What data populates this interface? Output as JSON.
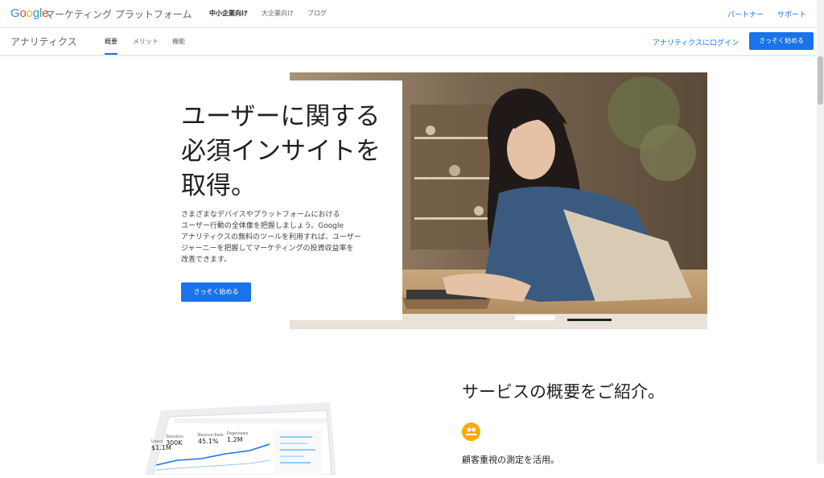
{
  "header": {
    "logo_parts": [
      "G",
      "o",
      "o",
      "g",
      "l",
      "e"
    ],
    "logo_colors": [
      "#4285f4",
      "#ea4335",
      "#fbbc05",
      "#4285f4",
      "#34a853",
      "#ea4335"
    ],
    "platform_title": "マーケティング プラットフォーム",
    "nav": [
      "中小企業向け",
      "大企業向け",
      "ブログ"
    ],
    "links": [
      "パートナー",
      "サポート"
    ]
  },
  "subnav": {
    "product": "アナリティクス",
    "tabs": [
      "概要",
      "メリット",
      "機能"
    ],
    "login": "アナリティクスにログイン",
    "cta": "さっそく始める"
  },
  "hero": {
    "title_lines": [
      "ユーザーに関する",
      "必須インサイトを",
      "取得。"
    ],
    "body_lines": [
      "さまざまなデバイスやプラットフォームにおける",
      "ユーザー行動の全体像を把握しましょう。Google",
      "アナリティクスの無料のツールを利用すれば、ユーザー",
      "ジャーニーを把握してマーケティングの投資収益率を",
      "改善できます。"
    ],
    "cta": "さっそく始める"
  },
  "overview": {
    "title": "サービスの概要をご紹介。",
    "feature_icon": "people-icon",
    "feature_text": "顧客重視の測定を活用。"
  },
  "device_stats": [
    {
      "label": "Users",
      "value": "$1.1M"
    },
    {
      "label": "Sessions",
      "value": "300K"
    },
    {
      "label": "Bounce Rate",
      "value": "45.1%"
    },
    {
      "label": "Pageviews",
      "value": "1.2M"
    }
  ],
  "colors": {
    "accent": "#1a73e8",
    "badge": "#f9ab00"
  }
}
